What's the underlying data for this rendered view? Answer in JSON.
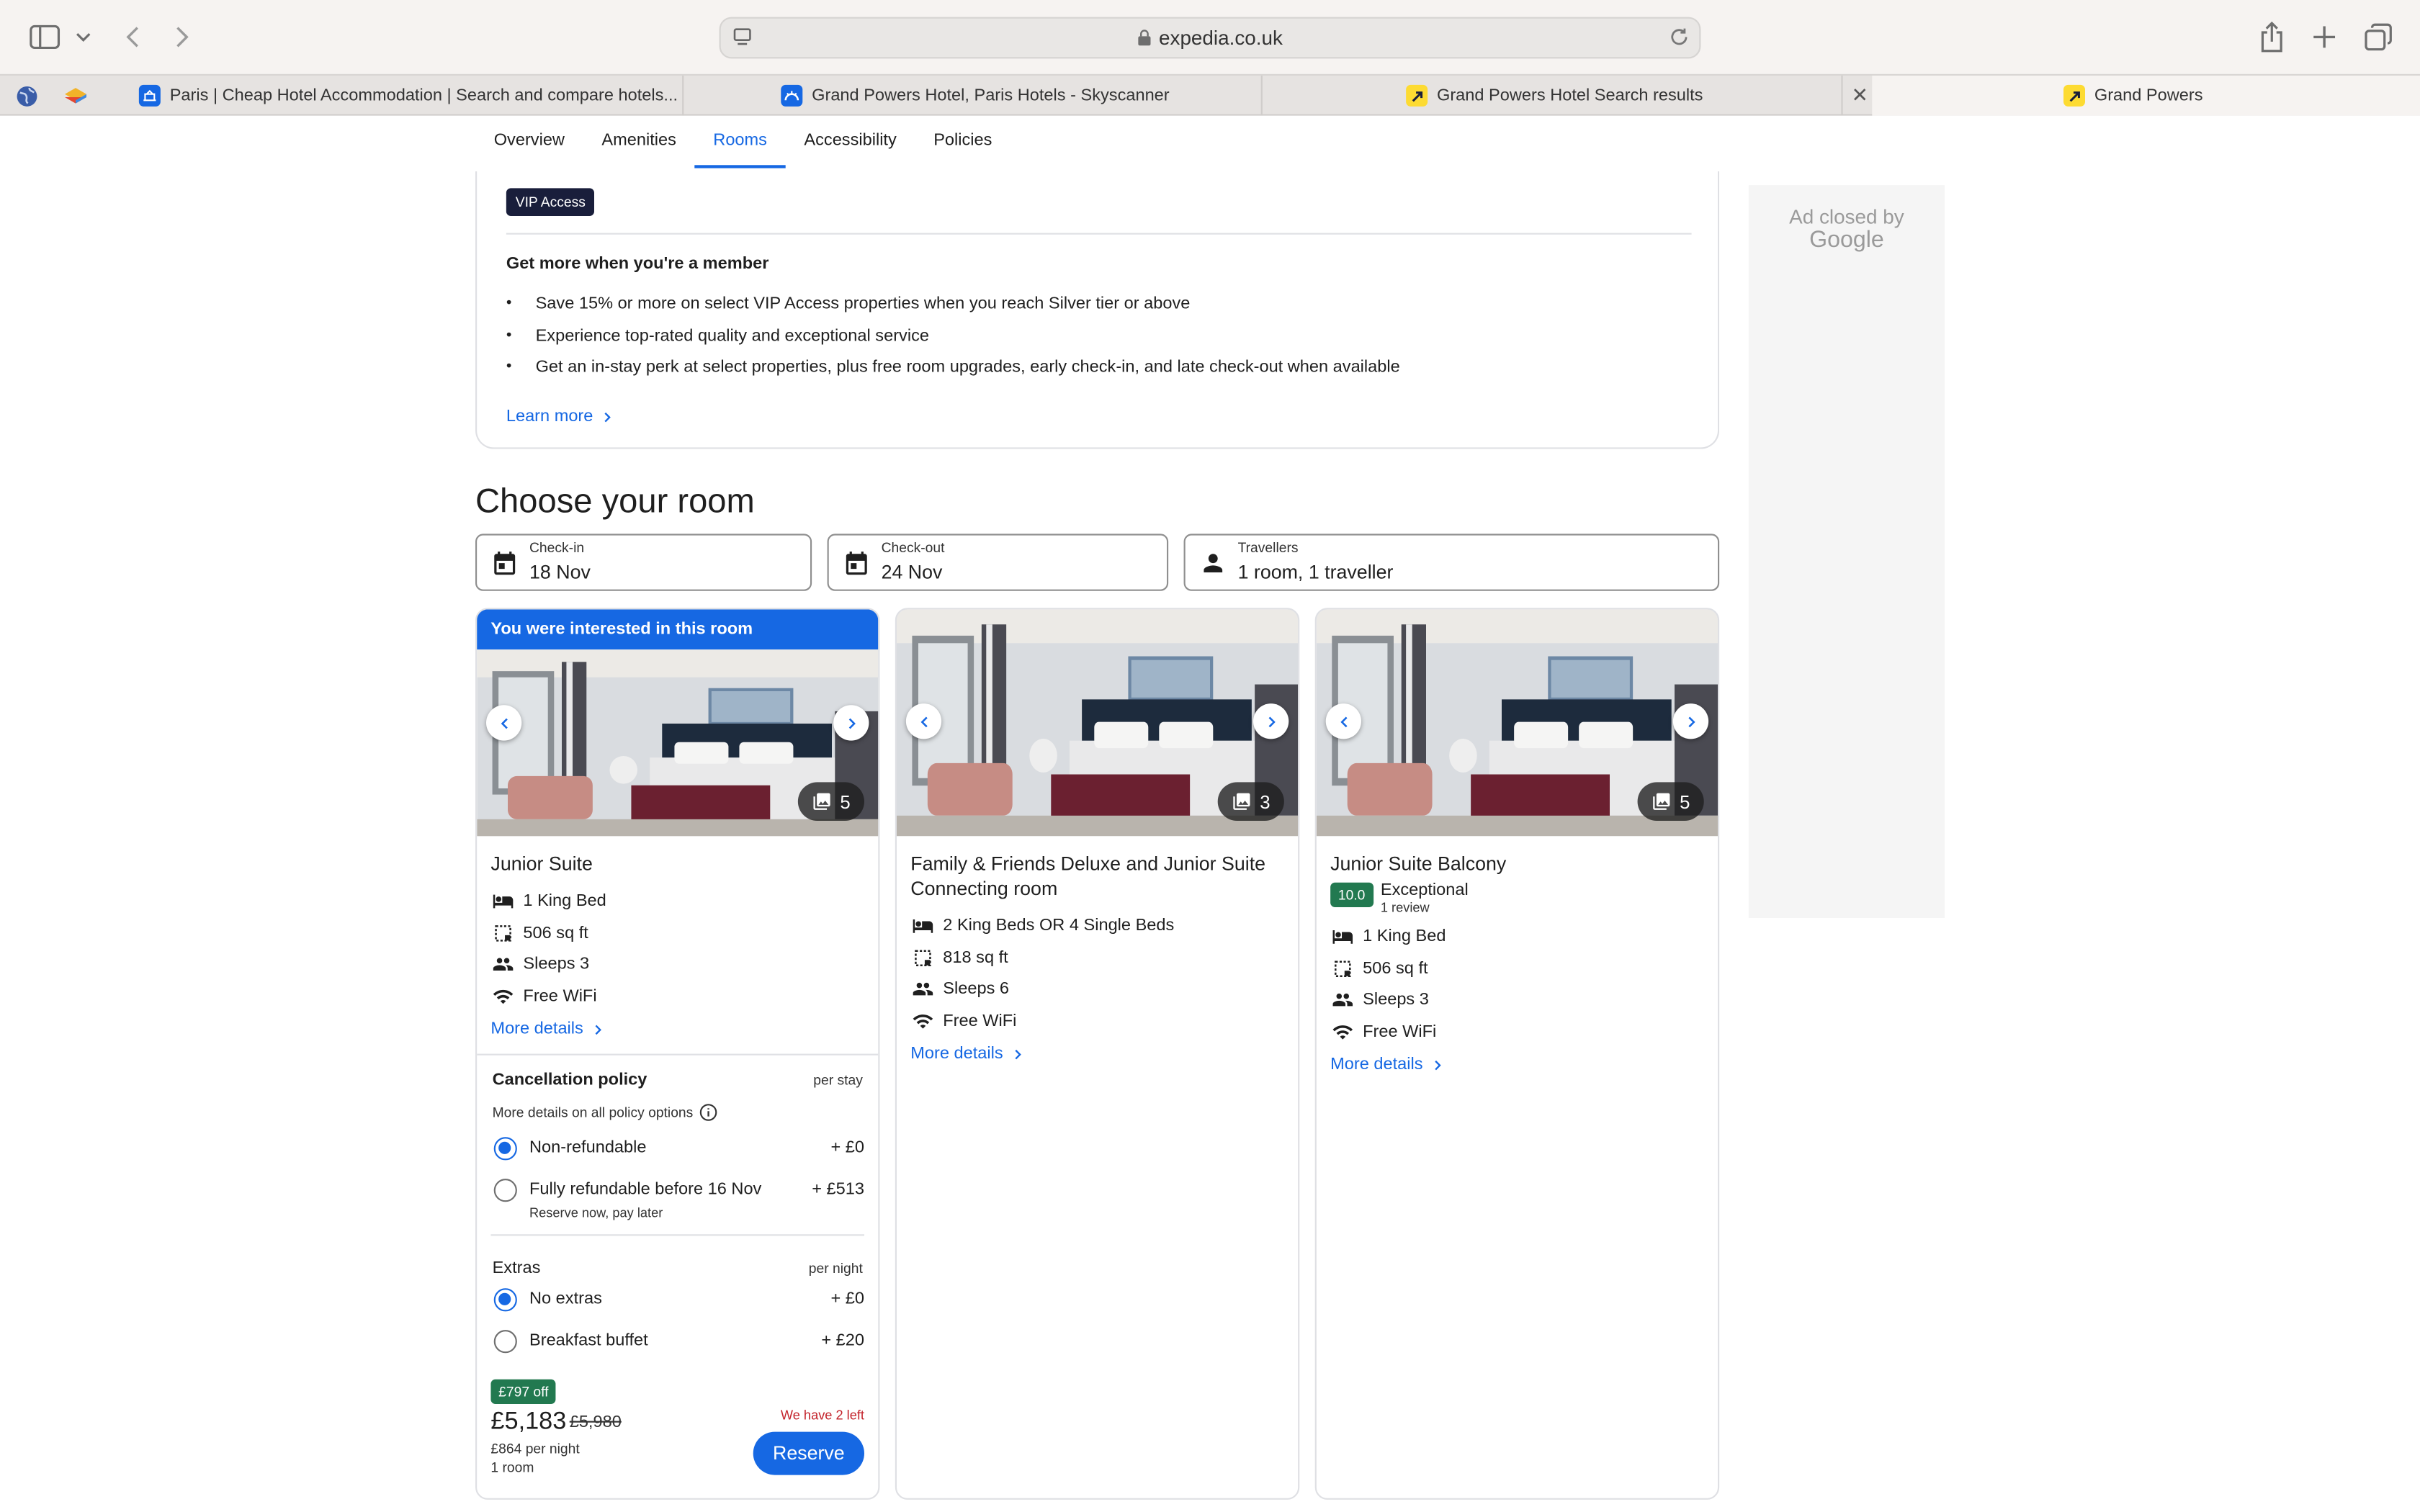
{
  "browser": {
    "url": "expedia.co.uk",
    "tabs": [
      {
        "title": "Paris | Cheap Hotel Accommodation | Search and compare hotels..."
      },
      {
        "title": "Grand Powers Hotel, Paris Hotels - Skyscanner"
      },
      {
        "title": "Grand Powers Hotel Search results"
      },
      {
        "title": "Grand Powers"
      }
    ],
    "close_glyph": "✕"
  },
  "subnav": {
    "items": [
      "Overview",
      "Amenities",
      "Rooms",
      "Accessibility",
      "Policies"
    ],
    "active": "Rooms"
  },
  "vip": {
    "badge": "VIP Access",
    "title": "Get more when you're a member",
    "bullets": [
      "Save 15% or more on select VIP Access properties when you reach Silver tier or above",
      "Experience top-rated quality and exceptional service",
      "Get an in-stay perk at select properties, plus free room upgrades, early check-in, and late check-out when available"
    ],
    "learn_more": "Learn more"
  },
  "ad": {
    "line1": "Ad closed by",
    "line2": "Google"
  },
  "choose": {
    "title": "Choose your room",
    "checkin": {
      "label": "Check-in",
      "value": "18 Nov"
    },
    "checkout": {
      "label": "Check-out",
      "value": "24 Nov"
    },
    "travellers": {
      "label": "Travellers",
      "value": "1 room, 1 traveller"
    }
  },
  "rooms": [
    {
      "banner": "You were interested in this room",
      "photo_count": "5",
      "name": "Junior Suite",
      "features": [
        "1 King Bed",
        "506 sq ft",
        "Sleeps 3",
        "Free WiFi"
      ],
      "more_details": "More details",
      "policy": {
        "title": "Cancellation policy",
        "per": "per stay",
        "more": "More details on all policy options",
        "options": [
          {
            "label": "Non-refundable",
            "price": "+ £0",
            "selected": true
          },
          {
            "label": "Fully refundable before 16 Nov",
            "price": "+ £513",
            "sub": "Reserve now, pay later",
            "selected": false
          }
        ]
      },
      "extras": {
        "title": "Extras",
        "per": "per night",
        "options": [
          {
            "label": "No extras",
            "price": "+ £0",
            "selected": true
          },
          {
            "label": "Breakfast buffet",
            "price": "+ £20",
            "selected": false
          }
        ]
      },
      "pricing": {
        "discount": "£797 off",
        "price": "£5,183",
        "old_price": "£5,980",
        "per_night": "£864 per night",
        "rooms": "1 room",
        "availability": "We have 2 left",
        "reserve": "Reserve"
      }
    },
    {
      "photo_count": "3",
      "name": "Family & Friends Deluxe and Junior Suite Connecting room",
      "features": [
        "2 King Beds OR 4 Single Beds",
        "818 sq ft",
        "Sleeps 6",
        "Free WiFi"
      ],
      "more_details": "More details"
    },
    {
      "photo_count": "5",
      "name": "Junior Suite Balcony",
      "rating": {
        "score": "10.0",
        "label": "Exceptional",
        "reviews": "1 review"
      },
      "features": [
        "1 King Bed",
        "506 sq ft",
        "Sleeps 3",
        "Free WiFi"
      ],
      "more_details": "More details"
    }
  ],
  "icons": [
    "sidebar-icon",
    "chevron-down-icon",
    "back-icon",
    "forward-icon",
    "lock-icon",
    "reload-icon",
    "share-icon",
    "plus-icon",
    "tabs-icon",
    "calendar-icon",
    "person-icon",
    "bed-icon",
    "area-icon",
    "people-icon",
    "wifi-icon",
    "gallery-icon",
    "info-icon"
  ],
  "colors": {
    "accent": "#1668e3",
    "dark": "#191e3b",
    "green": "#227950",
    "alert": "#c3232b"
  }
}
